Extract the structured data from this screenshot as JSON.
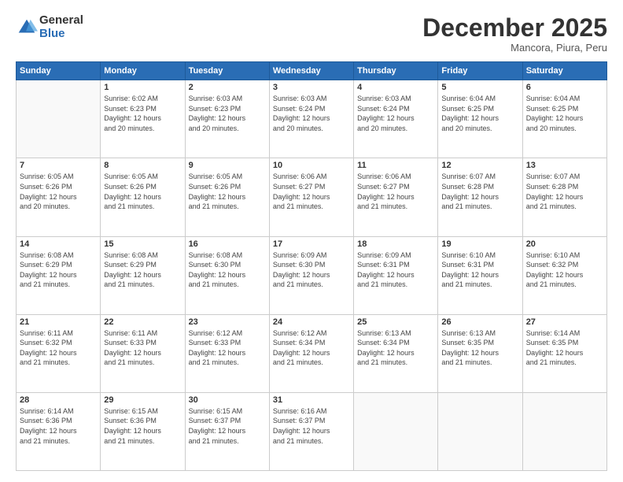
{
  "logo": {
    "general": "General",
    "blue": "Blue"
  },
  "header": {
    "month": "December 2025",
    "location": "Mancora, Piura, Peru"
  },
  "days_of_week": [
    "Sunday",
    "Monday",
    "Tuesday",
    "Wednesday",
    "Thursday",
    "Friday",
    "Saturday"
  ],
  "weeks": [
    [
      {
        "day": "",
        "info": ""
      },
      {
        "day": "1",
        "info": "Sunrise: 6:02 AM\nSunset: 6:23 PM\nDaylight: 12 hours\nand 20 minutes."
      },
      {
        "day": "2",
        "info": "Sunrise: 6:03 AM\nSunset: 6:23 PM\nDaylight: 12 hours\nand 20 minutes."
      },
      {
        "day": "3",
        "info": "Sunrise: 6:03 AM\nSunset: 6:24 PM\nDaylight: 12 hours\nand 20 minutes."
      },
      {
        "day": "4",
        "info": "Sunrise: 6:03 AM\nSunset: 6:24 PM\nDaylight: 12 hours\nand 20 minutes."
      },
      {
        "day": "5",
        "info": "Sunrise: 6:04 AM\nSunset: 6:25 PM\nDaylight: 12 hours\nand 20 minutes."
      },
      {
        "day": "6",
        "info": "Sunrise: 6:04 AM\nSunset: 6:25 PM\nDaylight: 12 hours\nand 20 minutes."
      }
    ],
    [
      {
        "day": "7",
        "info": "Sunrise: 6:05 AM\nSunset: 6:26 PM\nDaylight: 12 hours\nand 20 minutes."
      },
      {
        "day": "8",
        "info": "Sunrise: 6:05 AM\nSunset: 6:26 PM\nDaylight: 12 hours\nand 21 minutes."
      },
      {
        "day": "9",
        "info": "Sunrise: 6:05 AM\nSunset: 6:26 PM\nDaylight: 12 hours\nand 21 minutes."
      },
      {
        "day": "10",
        "info": "Sunrise: 6:06 AM\nSunset: 6:27 PM\nDaylight: 12 hours\nand 21 minutes."
      },
      {
        "day": "11",
        "info": "Sunrise: 6:06 AM\nSunset: 6:27 PM\nDaylight: 12 hours\nand 21 minutes."
      },
      {
        "day": "12",
        "info": "Sunrise: 6:07 AM\nSunset: 6:28 PM\nDaylight: 12 hours\nand 21 minutes."
      },
      {
        "day": "13",
        "info": "Sunrise: 6:07 AM\nSunset: 6:28 PM\nDaylight: 12 hours\nand 21 minutes."
      }
    ],
    [
      {
        "day": "14",
        "info": "Sunrise: 6:08 AM\nSunset: 6:29 PM\nDaylight: 12 hours\nand 21 minutes."
      },
      {
        "day": "15",
        "info": "Sunrise: 6:08 AM\nSunset: 6:29 PM\nDaylight: 12 hours\nand 21 minutes."
      },
      {
        "day": "16",
        "info": "Sunrise: 6:08 AM\nSunset: 6:30 PM\nDaylight: 12 hours\nand 21 minutes."
      },
      {
        "day": "17",
        "info": "Sunrise: 6:09 AM\nSunset: 6:30 PM\nDaylight: 12 hours\nand 21 minutes."
      },
      {
        "day": "18",
        "info": "Sunrise: 6:09 AM\nSunset: 6:31 PM\nDaylight: 12 hours\nand 21 minutes."
      },
      {
        "day": "19",
        "info": "Sunrise: 6:10 AM\nSunset: 6:31 PM\nDaylight: 12 hours\nand 21 minutes."
      },
      {
        "day": "20",
        "info": "Sunrise: 6:10 AM\nSunset: 6:32 PM\nDaylight: 12 hours\nand 21 minutes."
      }
    ],
    [
      {
        "day": "21",
        "info": "Sunrise: 6:11 AM\nSunset: 6:32 PM\nDaylight: 12 hours\nand 21 minutes."
      },
      {
        "day": "22",
        "info": "Sunrise: 6:11 AM\nSunset: 6:33 PM\nDaylight: 12 hours\nand 21 minutes."
      },
      {
        "day": "23",
        "info": "Sunrise: 6:12 AM\nSunset: 6:33 PM\nDaylight: 12 hours\nand 21 minutes."
      },
      {
        "day": "24",
        "info": "Sunrise: 6:12 AM\nSunset: 6:34 PM\nDaylight: 12 hours\nand 21 minutes."
      },
      {
        "day": "25",
        "info": "Sunrise: 6:13 AM\nSunset: 6:34 PM\nDaylight: 12 hours\nand 21 minutes."
      },
      {
        "day": "26",
        "info": "Sunrise: 6:13 AM\nSunset: 6:35 PM\nDaylight: 12 hours\nand 21 minutes."
      },
      {
        "day": "27",
        "info": "Sunrise: 6:14 AM\nSunset: 6:35 PM\nDaylight: 12 hours\nand 21 minutes."
      }
    ],
    [
      {
        "day": "28",
        "info": "Sunrise: 6:14 AM\nSunset: 6:36 PM\nDaylight: 12 hours\nand 21 minutes."
      },
      {
        "day": "29",
        "info": "Sunrise: 6:15 AM\nSunset: 6:36 PM\nDaylight: 12 hours\nand 21 minutes."
      },
      {
        "day": "30",
        "info": "Sunrise: 6:15 AM\nSunset: 6:37 PM\nDaylight: 12 hours\nand 21 minutes."
      },
      {
        "day": "31",
        "info": "Sunrise: 6:16 AM\nSunset: 6:37 PM\nDaylight: 12 hours\nand 21 minutes."
      },
      {
        "day": "",
        "info": ""
      },
      {
        "day": "",
        "info": ""
      },
      {
        "day": "",
        "info": ""
      }
    ]
  ]
}
